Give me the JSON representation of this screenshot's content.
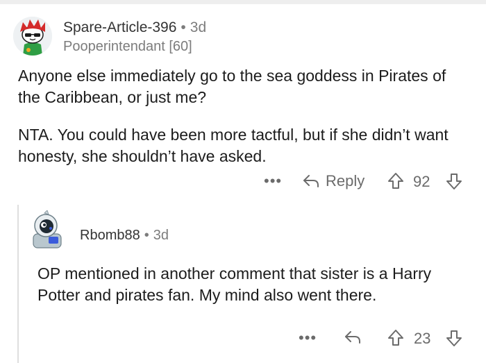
{
  "comment": {
    "author": "Spare-Article-396",
    "age": "3d",
    "flair": "Pooperintendant [60]",
    "paragraphs": [
      "Anyone else immediately go to the sea goddess in Pirates of the Caribbean, or just me?",
      "NTA. You could have been more tactful, but if she didn’t want honesty, she shouldn’t have asked."
    ],
    "actions": {
      "more": "•••",
      "reply_label": "Reply",
      "score": "92"
    }
  },
  "reply": {
    "author": "Rbomb88",
    "age": "3d",
    "text": "OP mentioned in another comment that sister is a Harry Potter and pirates fan. My mind also went there.",
    "actions": {
      "more": "•••",
      "score": "23"
    }
  },
  "separator": "•",
  "colors": {
    "text": "#1c1c1c",
    "meta": "#7c7c7c",
    "action": "#6b6b6b",
    "thread_line": "#dedede"
  },
  "icons": [
    "reply-arrow-icon",
    "upvote-icon",
    "downvote-icon",
    "more-options-icon"
  ]
}
